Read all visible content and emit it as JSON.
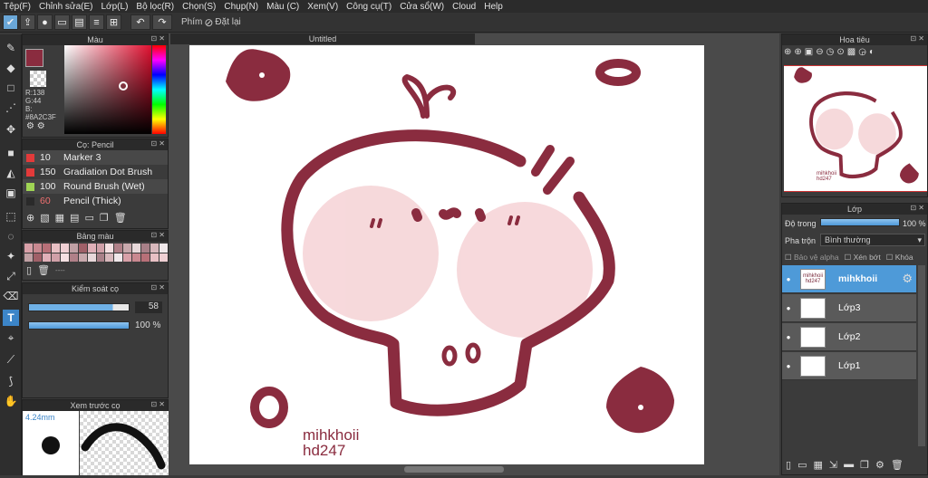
{
  "menu": [
    "Tệp(F)",
    "Chỉnh sửa(E)",
    "Lớp(L)",
    "Bộ lọc(R)",
    "Chọn(S)",
    "Chụp(N)",
    "Màu (C)",
    "Xem(V)",
    "Công cụ(T)",
    "Cửa sổ(W)",
    "Cloud",
    "Help"
  ],
  "toolbar": {
    "shortcut_label": "Phím",
    "reset_label": "Đặt lại"
  },
  "document": {
    "title": "Untitled"
  },
  "color_panel": {
    "title": "Màu",
    "r": "R:138",
    "g": "G:44",
    "b": "B:",
    "hex": "#8A2C3F",
    "accent": "#8A2C3F"
  },
  "brush_panel": {
    "title": "Cọ: Pencil",
    "items": [
      {
        "size": "10",
        "name": "Marker 3",
        "color": "#e23a3a"
      },
      {
        "size": "150",
        "name": "Gradiation Dot Brush",
        "color": "#e23a3a"
      },
      {
        "size": "100",
        "name": "Round Brush (Wet)",
        "color": "#9fd454"
      },
      {
        "size": "60",
        "name": "Pencil (Thick)",
        "color": "#2a2a2a"
      }
    ]
  },
  "palette_panel": {
    "title": "Bảng màu",
    "ellipsis": "----"
  },
  "brush_control": {
    "title": "Kiểm soát cọ",
    "size": "58",
    "size_fraction": 0.84,
    "opacity": "100 %",
    "opacity_fraction": 1.0
  },
  "preview_panel": {
    "title": "Xem trước cọ",
    "size_label": "4.24mm"
  },
  "navigator": {
    "title": "Hoa tiêu"
  },
  "layers_panel": {
    "title": "Lớp",
    "opacity_label": "Độ trong",
    "opacity_value": "100 %",
    "blend_label": "Pha trộn",
    "blend_value": "Bình thường",
    "protect_alpha": "Bảo vệ alpha",
    "clipping": "Xén bớt",
    "lock": "Khóa",
    "layers": [
      {
        "name": "mihkhoii",
        "thumb": "mihkhoii hd247"
      },
      {
        "name": "Lớp3",
        "thumb": ""
      },
      {
        "name": "Lớp2",
        "thumb": ""
      },
      {
        "name": "Lớp1",
        "thumb": ""
      }
    ]
  },
  "artwork": {
    "signature_line1": "mihkhoii",
    "signature_line2": "hd247",
    "stroke_color": "#8A2C3F",
    "blush_color": "#f3c9cd"
  }
}
